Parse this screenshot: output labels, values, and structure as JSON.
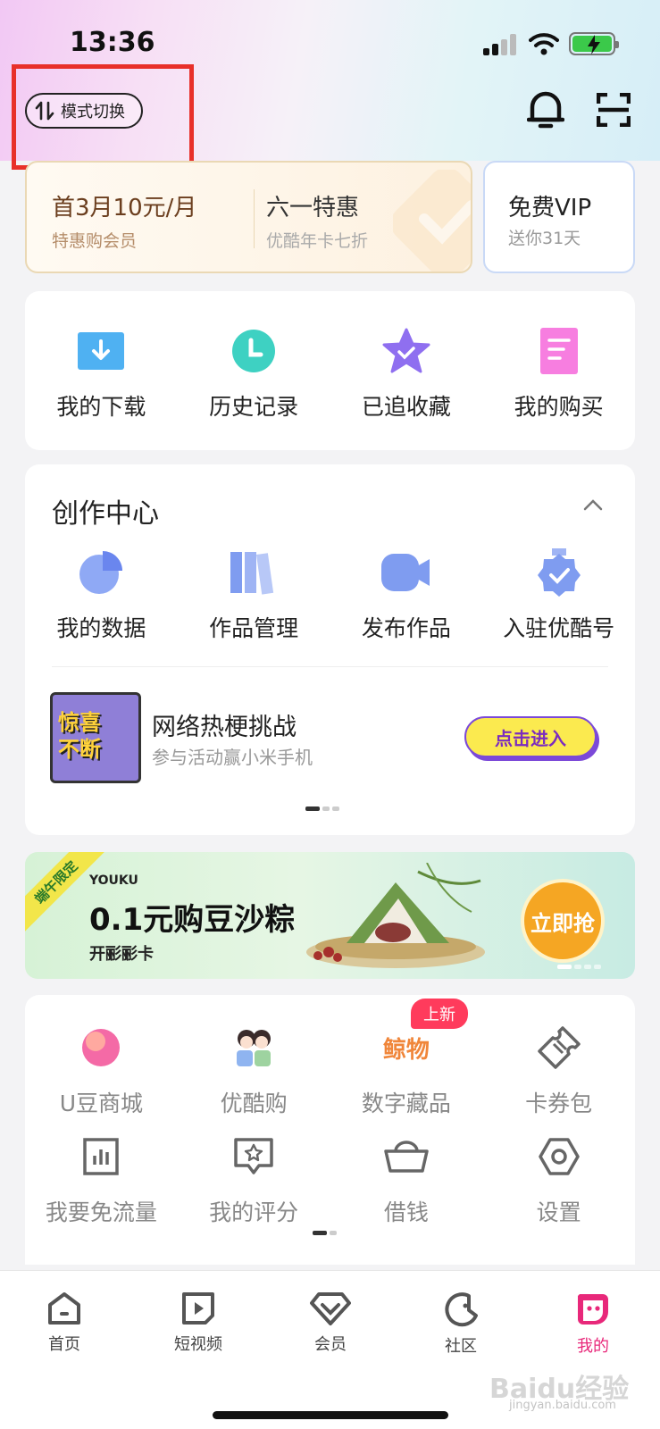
{
  "status": {
    "time": "13:36"
  },
  "header": {
    "mode_switch_label": "模式切换"
  },
  "vip": {
    "items": [
      {
        "title": "首3月10元/月",
        "sub": "特惠购会员"
      },
      {
        "title": "六一特惠",
        "sub": "优酷年卡七折"
      }
    ],
    "free": {
      "title": "免费VIP",
      "sub": "送你31天"
    }
  },
  "quick": {
    "items": [
      "我的下载",
      "历史记录",
      "已追收藏",
      "我的购买"
    ]
  },
  "creator": {
    "title": "创作中心",
    "items": [
      "我的数据",
      "作品管理",
      "发布作品",
      "入驻优酷号"
    ],
    "promo": {
      "image_text_1": "惊喜",
      "image_text_2": "不断",
      "title": "网络热梗挑战",
      "sub": "参与活动赢小米手机",
      "button": "点击进入"
    }
  },
  "banner": {
    "ribbon": "端午限定",
    "brand": "YOUKU",
    "title": "0.1元购豆沙粽",
    "sub": "开彨彨卡",
    "button": "立即抢"
  },
  "services": {
    "new_badge": "上新",
    "row1": [
      "U豆商城",
      "优酷购",
      "数字藏品",
      "卡券包"
    ],
    "row2": [
      "我要免流量",
      "我的评分",
      "借钱",
      "设置"
    ],
    "digital_logo_text": "鲸物"
  },
  "tabbar": {
    "items": [
      "首页",
      "短视频",
      "会员",
      "社区",
      "我的"
    ]
  },
  "watermark": {
    "main": "Baidu经验",
    "sub": "jingyan.baidu.com"
  },
  "colors": {
    "accent": "#e8287a",
    "highlight_box": "#e8302a"
  }
}
